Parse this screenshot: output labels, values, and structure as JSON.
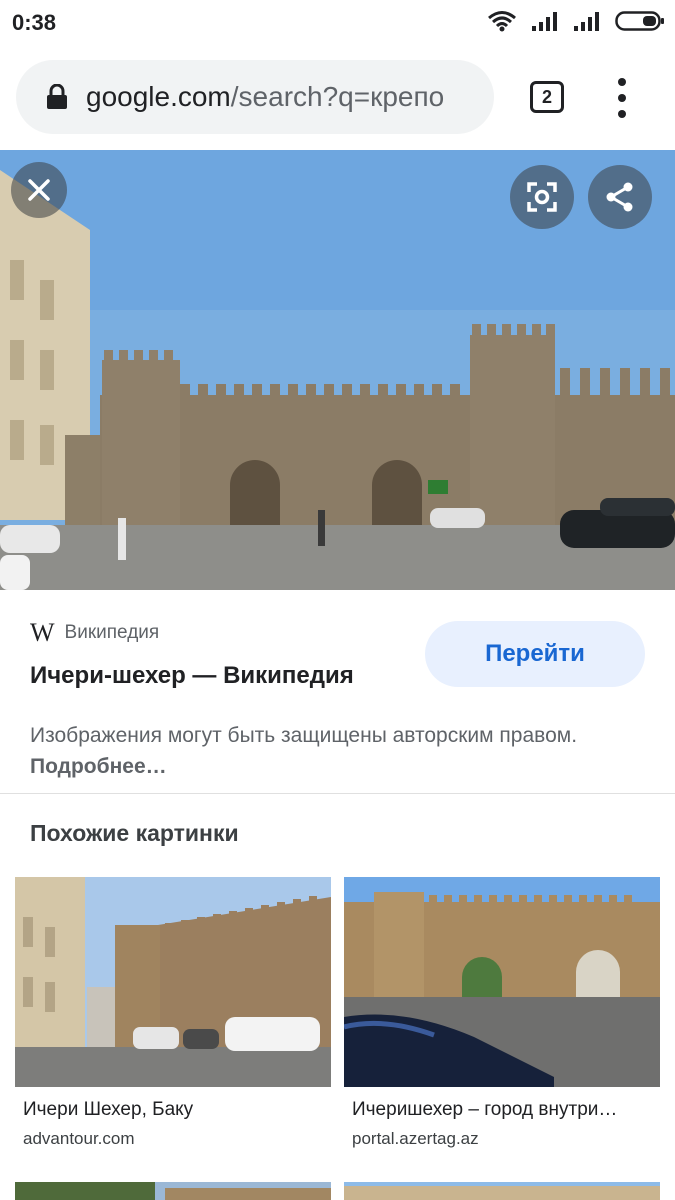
{
  "status_bar": {
    "time": "0:38",
    "icons": [
      "wifi-icon",
      "signal-icon",
      "signal-icon",
      "battery-icon"
    ]
  },
  "browser": {
    "url_host": "google.com",
    "url_path": "/search?q=крепо",
    "tab_count": "2"
  },
  "hero": {
    "colors": {
      "sky": "#7aaee0",
      "wall": "#8b7c66",
      "ground": "#8e8e8a"
    }
  },
  "result": {
    "source": "Википедия",
    "title": "Ичери-шехер — Википедия",
    "visit_label": "Перейти",
    "copyright_text": "Изображения могут быть защищены авторским правом.",
    "more_label": "Подробнее…"
  },
  "related": {
    "heading": "Похожие картинки",
    "items": [
      {
        "caption": "Ичери Шехер, Баку",
        "domain": "advantour.com"
      },
      {
        "caption": "Ичеришехер – город внутри…",
        "domain": "portal.azertag.az"
      }
    ]
  },
  "colors": {
    "accent": "#1967d2",
    "accent_bg": "#e8f0fe",
    "muted_text": "#5f6368"
  }
}
